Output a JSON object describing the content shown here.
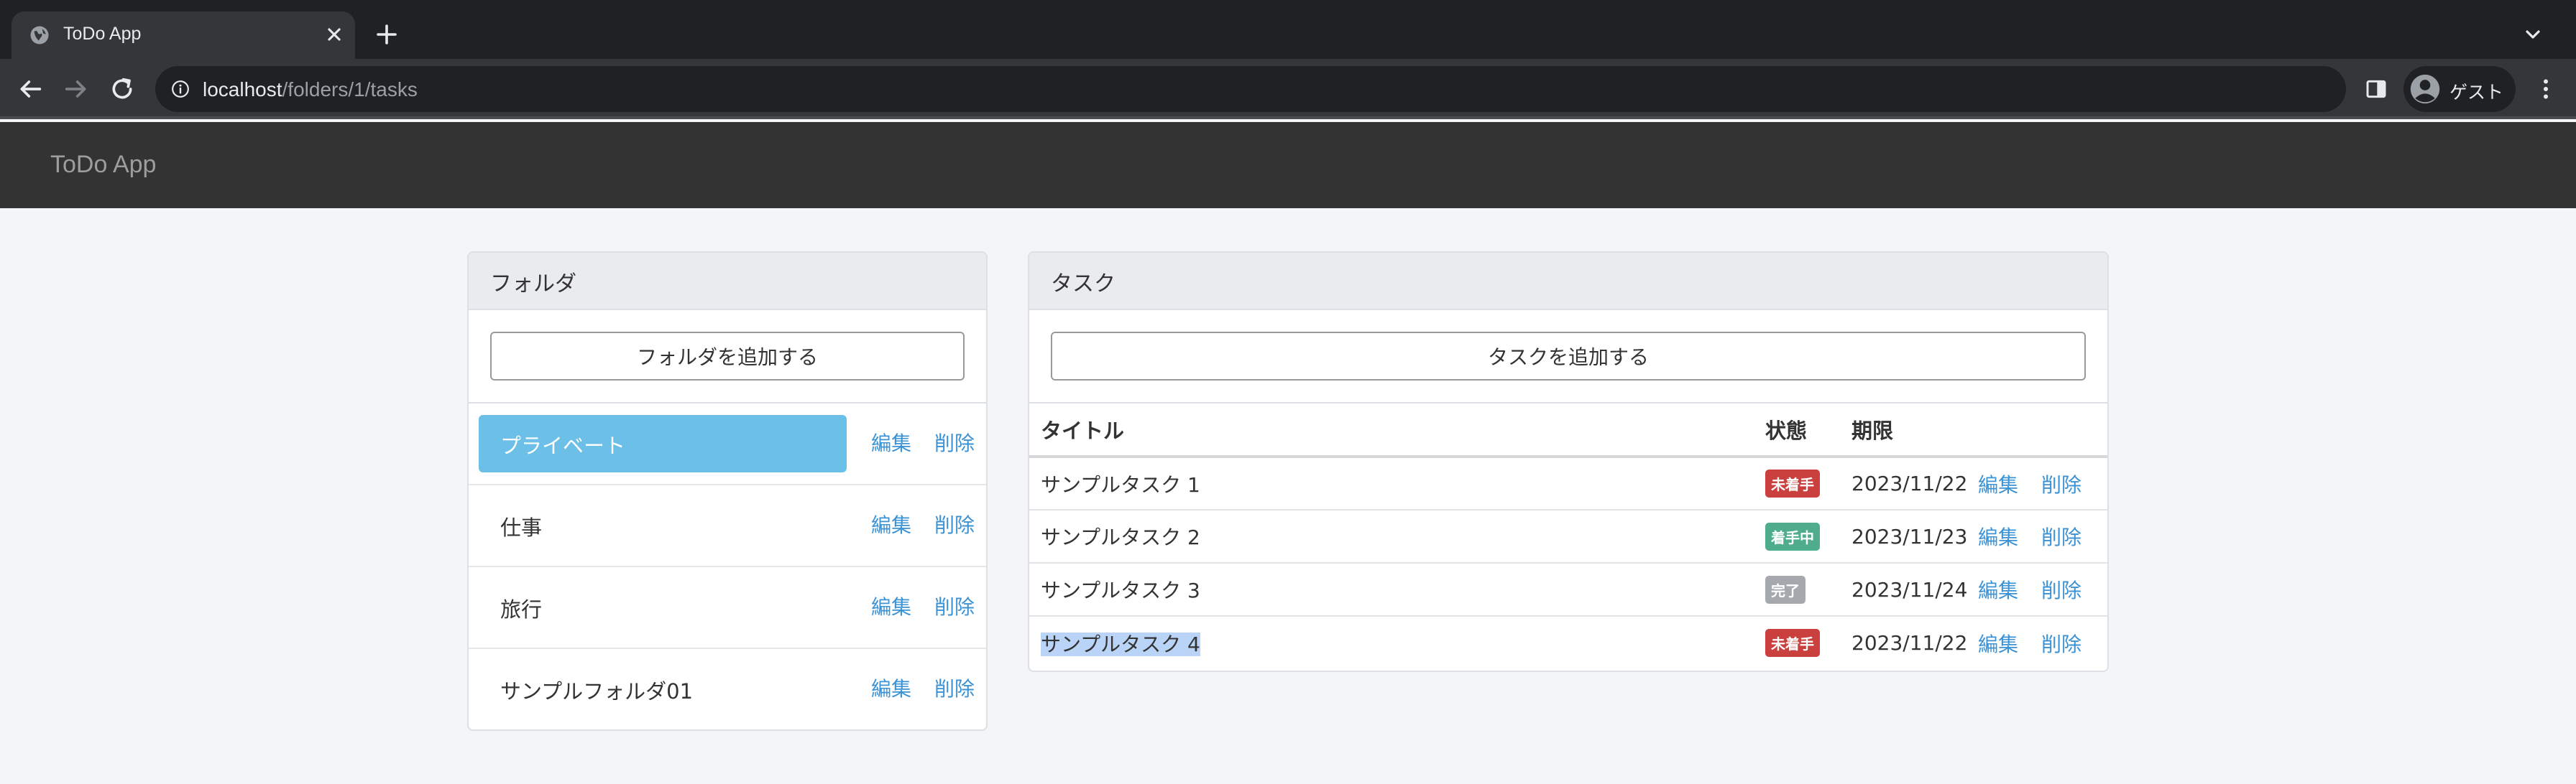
{
  "browser": {
    "tab_title": "ToDo App",
    "url_host": "localhost",
    "url_path": "/folders/1/tasks",
    "profile_name": "ゲスト"
  },
  "app": {
    "brand": "ToDo App"
  },
  "folders": {
    "heading": "フォルダ",
    "add_button": "フォルダを追加する",
    "edit_label": "編集",
    "delete_label": "削除",
    "items": [
      {
        "name": "プライベート",
        "active": true
      },
      {
        "name": "仕事",
        "active": false
      },
      {
        "name": "旅行",
        "active": false
      },
      {
        "name": "サンプルフォルダ01",
        "active": false
      }
    ]
  },
  "tasks": {
    "heading": "タスク",
    "add_button": "タスクを追加する",
    "columns": {
      "title": "タイトル",
      "status": "状態",
      "due": "期限"
    },
    "edit_label": "編集",
    "delete_label": "削除",
    "rows": [
      {
        "title": "サンプルタスク 1",
        "status": "未着手",
        "due": "2023/11/22"
      },
      {
        "title": "サンプルタスク 2",
        "status": "着手中",
        "due": "2023/11/23"
      },
      {
        "title": "サンプルタスク 3",
        "status": "完了",
        "due": "2023/11/24"
      },
      {
        "title": "サンプルタスク 4",
        "status": "未着手",
        "due": "2023/11/22"
      }
    ]
  },
  "colors": {
    "status_todo": "#c9403e",
    "status_doing": "#4fad8e",
    "status_done": "#a5a8ad",
    "active_folder": "#6cbfe6",
    "link": "#3b93d6"
  }
}
